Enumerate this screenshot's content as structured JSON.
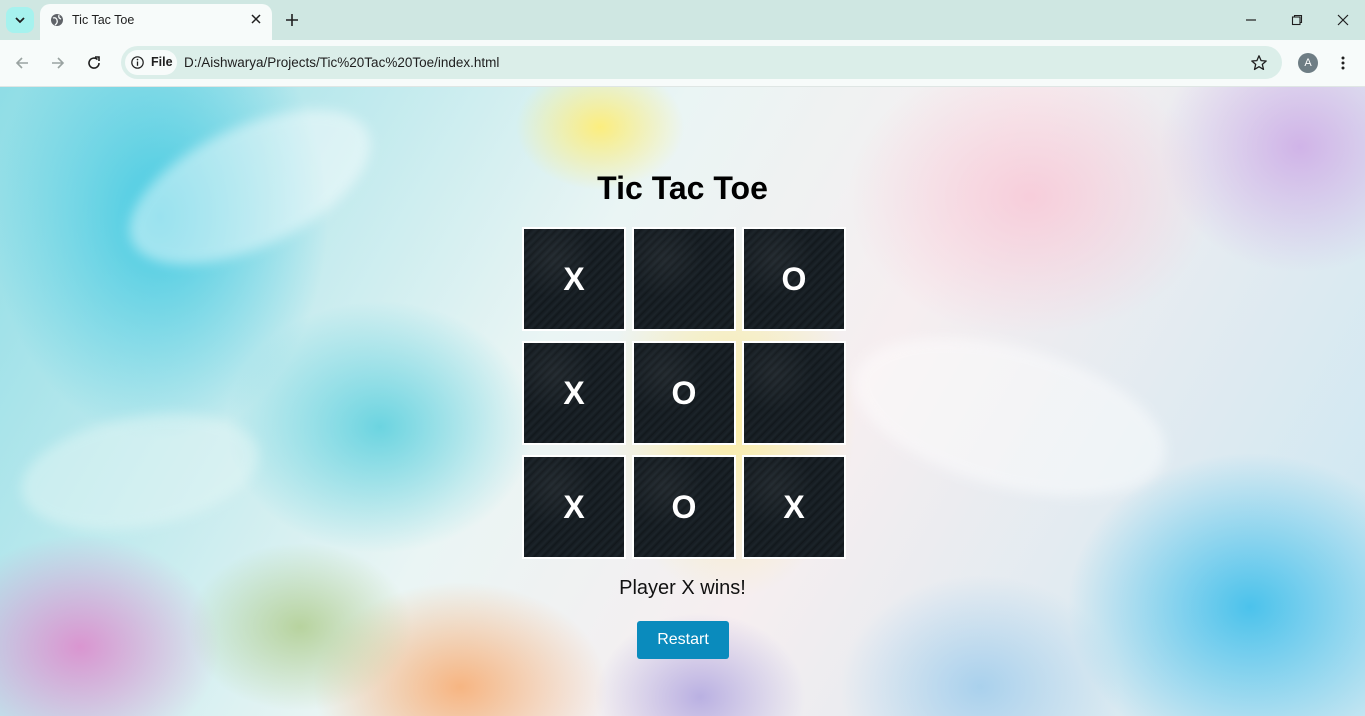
{
  "browser": {
    "tab_title": "Tic Tac Toe",
    "site_chip_label": "File",
    "url": "D:/Aishwarya/Projects/Tic%20Tac%20Toe/index.html",
    "avatar_letter": "A"
  },
  "page": {
    "title": "Tic Tac Toe",
    "status": "Player X wins!",
    "restart_label": "Restart"
  },
  "board": {
    "cells": [
      "X",
      "",
      "O",
      "X",
      "O",
      "",
      "X",
      "O",
      "X"
    ]
  },
  "colors": {
    "cell_background": "#161d22",
    "cell_border": "#ffffff",
    "button": "#0a8bbd"
  }
}
